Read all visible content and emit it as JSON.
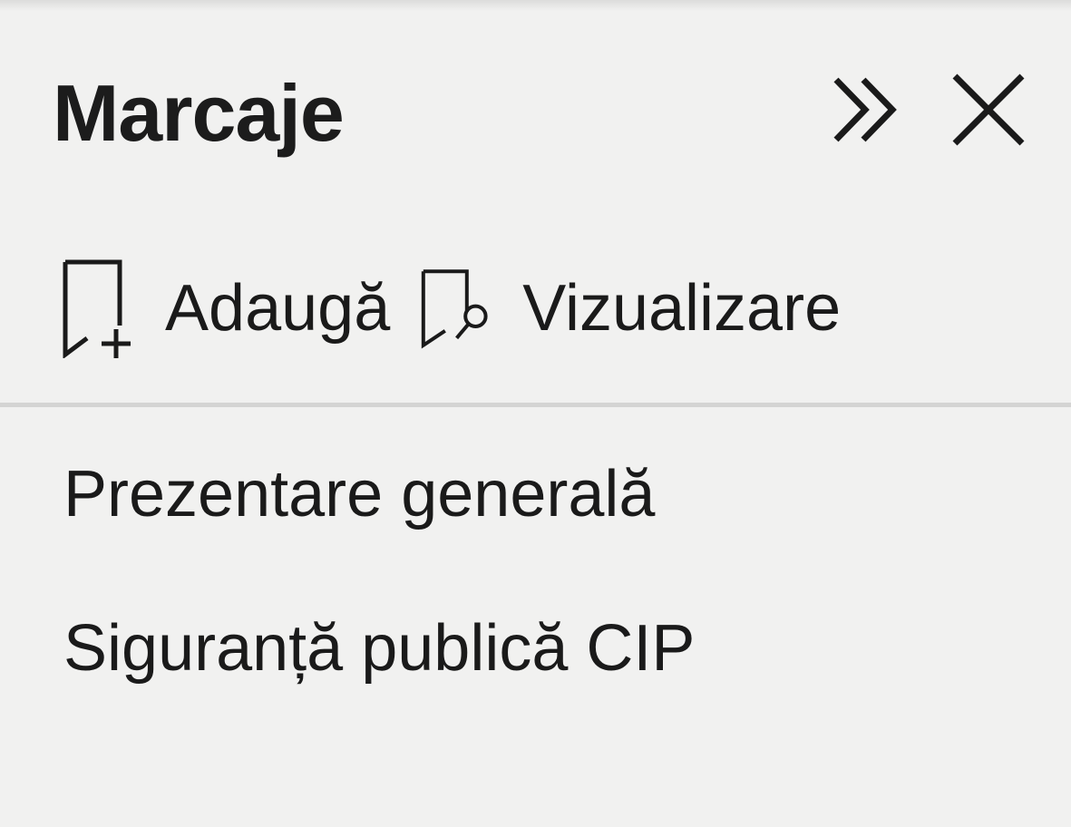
{
  "panel": {
    "title": "Marcaje",
    "expand_icon": "double-chevron-right-icon",
    "close_icon": "close-icon"
  },
  "toolbar": {
    "add": {
      "label": "Adaugă",
      "icon": "bookmark-add-icon"
    },
    "view": {
      "label": "Vizualizare",
      "icon": "bookmark-view-icon"
    }
  },
  "bookmarks": [
    {
      "label": "Prezentare generală"
    },
    {
      "label": "Siguranță publică CIP"
    }
  ],
  "colors": {
    "background": "#f1f1f0",
    "text": "#1a1a1a",
    "divider": "#d4d4d3"
  }
}
